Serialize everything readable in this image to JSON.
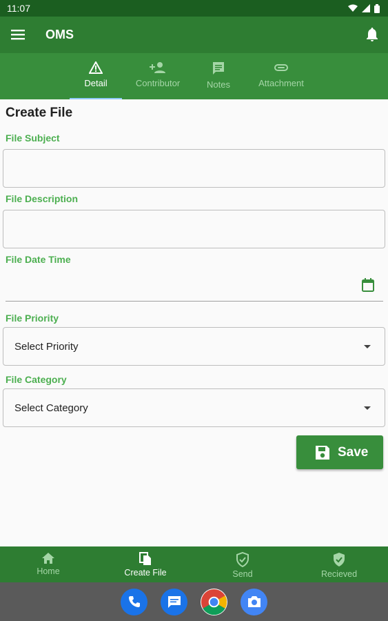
{
  "status_bar": {
    "time": "11:07",
    "icons": [
      "wifi-icon",
      "signal-icon",
      "battery-icon"
    ]
  },
  "app_bar": {
    "title": "OMS",
    "menu_icon": "menu-icon",
    "notification_icon": "bell-icon"
  },
  "tabs": [
    {
      "label": "Detail",
      "icon": "warning-icon",
      "active": true
    },
    {
      "label": "Contributor",
      "icon": "person-add-icon",
      "active": false
    },
    {
      "label": "Notes",
      "icon": "note-icon",
      "active": false
    },
    {
      "label": "Attachment",
      "icon": "attachment-icon",
      "active": false
    }
  ],
  "form": {
    "title": "Create File",
    "subject": {
      "label": "File Subject",
      "value": ""
    },
    "description": {
      "label": "File Description",
      "value": ""
    },
    "date_time": {
      "label": "File Date Time",
      "value": ""
    },
    "priority": {
      "label": "File Priority",
      "selected": "Select Priority"
    },
    "category": {
      "label": "File Category",
      "selected": "Select Category"
    },
    "save_label": "Save"
  },
  "bottom_nav": [
    {
      "label": "Home",
      "icon": "home-icon",
      "active": false
    },
    {
      "label": "Create File",
      "icon": "copy-file-icon",
      "active": true
    },
    {
      "label": "Send",
      "icon": "shield-check-icon",
      "active": false
    },
    {
      "label": "Recieved",
      "icon": "verified-icon",
      "active": false
    }
  ],
  "dock_apps": [
    "phone-app-icon",
    "messages-app-icon",
    "chrome-app-icon",
    "camera-app-icon"
  ],
  "colors": {
    "primary": "#2e7d32",
    "primary_dark": "#1b5e20",
    "accent_label": "#4caf50",
    "tab_indicator": "#90caf9"
  }
}
